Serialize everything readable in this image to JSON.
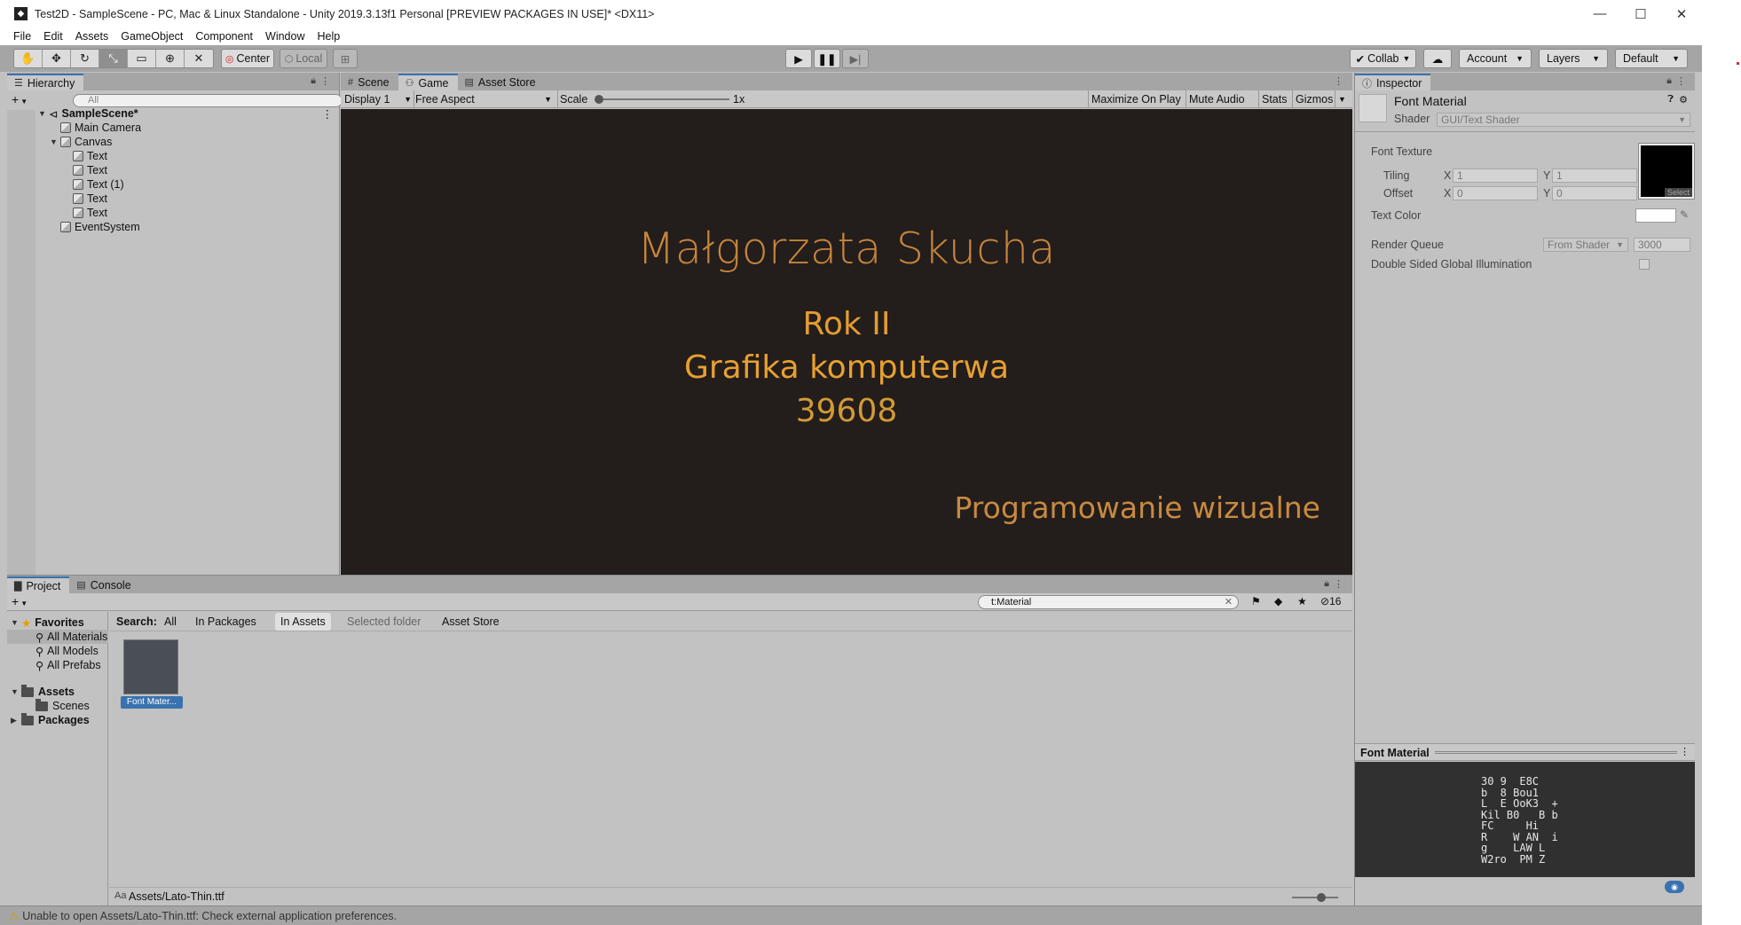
{
  "window": {
    "title": "Test2D - SampleScene - PC, Mac & Linux Standalone - Unity 2019.3.13f1 Personal [PREVIEW PACKAGES IN USE]* <DX11>",
    "minimize": "—",
    "maximize": "☐",
    "close": "✕"
  },
  "menu": [
    "File",
    "Edit",
    "Assets",
    "GameObject",
    "Component",
    "Window",
    "Help"
  ],
  "toolbar": {
    "pivot": "Center",
    "space": "Local",
    "collab": "Collab",
    "account": "Account",
    "layers": "Layers",
    "layout": "Default"
  },
  "hierarchy": {
    "tab": "Hierarchy",
    "search_placeholder": "All",
    "items": [
      {
        "label": "SampleScene*"
      },
      {
        "label": "Main Camera"
      },
      {
        "label": "Canvas"
      },
      {
        "label": "Text"
      },
      {
        "label": "Text"
      },
      {
        "label": "Text (1)"
      },
      {
        "label": "Text"
      },
      {
        "label": "Text"
      },
      {
        "label": "EventSystem"
      }
    ]
  },
  "center_tabs": {
    "scene": "Scene",
    "game": "Game",
    "store": "Asset Store"
  },
  "game_toolbar": {
    "display": "Display 1",
    "aspect": "Free Aspect",
    "scale_label": "Scale",
    "scale_value": "1x",
    "maximize": "Maximize On Play",
    "mute": "Mute Audio",
    "stats": "Stats",
    "gizmos": "Gizmos"
  },
  "game_view": {
    "name": "Małgorzata Skucha",
    "year": "Rok II",
    "subject": "Grafika komputerwa",
    "id": "39608",
    "course": "Programowanie wizualne",
    "bg_color": "#231d1c",
    "text_color": "#e8a33a"
  },
  "inspector": {
    "tab": "Inspector",
    "material_name": "Font Material",
    "shader_label": "Shader",
    "shader_value": "GUI/Text Shader",
    "font_texture": "Font Texture",
    "tiling": "Tiling",
    "offset": "Offset",
    "x": "X",
    "y": "Y",
    "tiling_x": "1",
    "tiling_y": "1",
    "offset_x": "0",
    "offset_y": "0",
    "select": "Select",
    "text_color": "Text Color",
    "render_queue": "Render Queue",
    "render_queue_mode": "From Shader",
    "render_queue_value": "3000",
    "double_sided": "Double Sided Global Illumination",
    "preview_title": "Font Material",
    "preview_glyphs": [
      "30 9  E8C",
      "b  8 Bou1",
      "L  E OoK3  +",
      "Kil B0   B b",
      "FC     Hi",
      "R    W AN  i",
      "g    LAW L",
      "W2ro  PM Z"
    ]
  },
  "project": {
    "tab_project": "Project",
    "tab_console": "Console",
    "search_value": "t:Material",
    "hidden_count": "16",
    "favorites": "Favorites",
    "fav_items": [
      "All Materials",
      "All Models",
      "All Prefabs"
    ],
    "assets": "Assets",
    "scenes": "Scenes",
    "packages": "Packages",
    "search_label": "Search:",
    "filters": [
      "All",
      "In Packages",
      "In Assets",
      "Selected folder",
      "Asset Store"
    ],
    "asset_name": "Font Mater...",
    "path": "Assets/Lato-Thin.ttf",
    "path_prefix": "Aa"
  },
  "status": {
    "message": "Unable to open Assets/Lato-Thin.ttf: Check external application preferences."
  }
}
